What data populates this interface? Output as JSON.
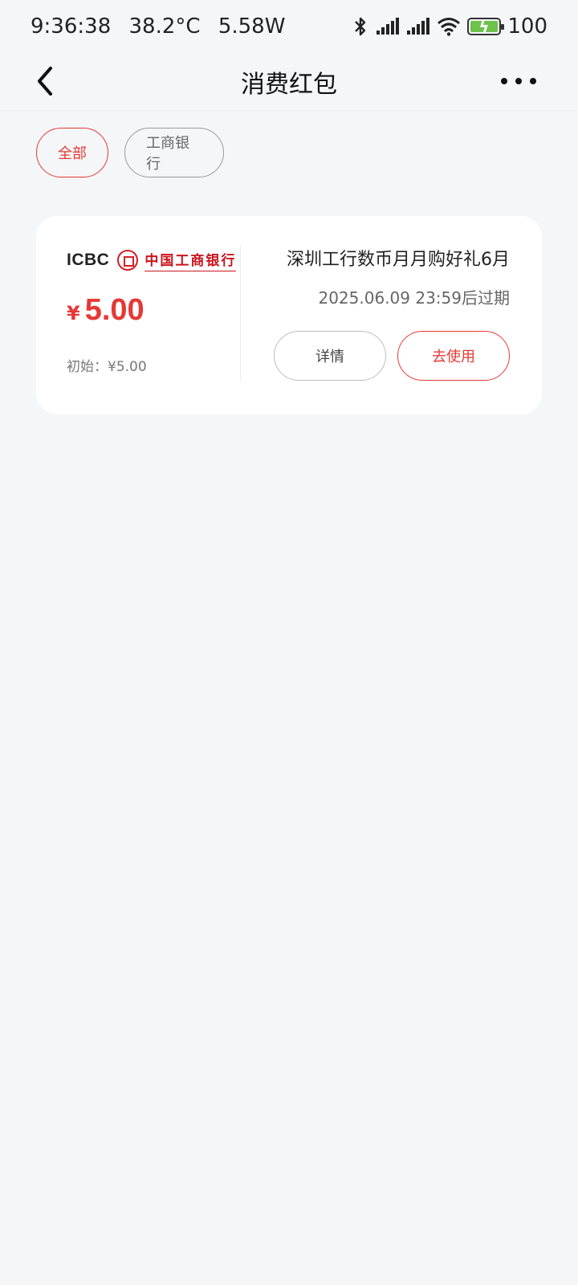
{
  "status_bar": {
    "time": "9:36:38",
    "temperature": "38.2°C",
    "power": "5.58W",
    "battery": "100",
    "icons": [
      "bluetooth-icon",
      "signal-icon",
      "signal-icon",
      "wifi-icon",
      "battery-icon"
    ]
  },
  "nav": {
    "title": "消费红包",
    "back_icon": "chevron-left-icon",
    "more_icon": "more-horizontal-icon"
  },
  "filters": [
    {
      "label": "全部",
      "active": true
    },
    {
      "label": "工商银行",
      "active": false
    }
  ],
  "card": {
    "logo_text_en": "ICBC",
    "logo_text_cn": "中国工商银行",
    "currency_symbol": "¥",
    "amount": "5.00",
    "initial": "初始：¥5.00",
    "coupon_name": "深圳工行数币月月购好礼6月",
    "expiry": "2025.06.09 23:59后过期",
    "detail_label": "详情",
    "use_label": "去使用"
  },
  "colors": {
    "accent": "#e53935",
    "background": "#f5f6f8",
    "card": "#ffffff",
    "brand_red": "#c9151e"
  }
}
